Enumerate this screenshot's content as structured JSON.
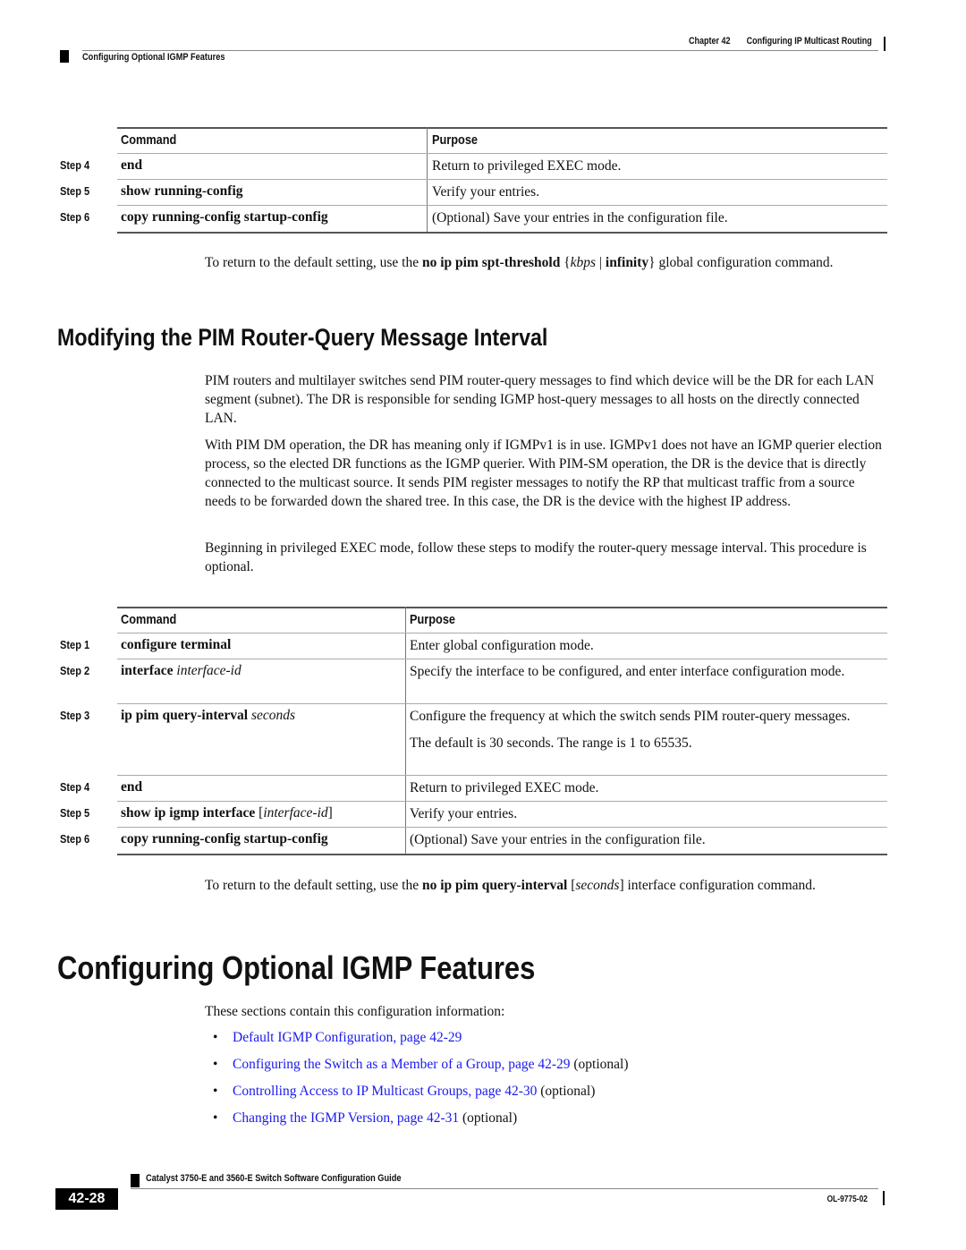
{
  "header": {
    "chapter": "Chapter 42",
    "chapter_title": "Configuring IP Multicast Routing",
    "section": "Configuring Optional IGMP Features"
  },
  "table1": {
    "col_command": "Command",
    "col_purpose": "Purpose",
    "rows": [
      {
        "step": "Step 4",
        "cmd_bold": "end",
        "cmd_rest": "",
        "purpose": [
          "Return to privileged EXEC mode."
        ]
      },
      {
        "step": "Step 5",
        "cmd_bold": "show running-config",
        "cmd_rest": "",
        "purpose": [
          "Verify your entries."
        ]
      },
      {
        "step": "Step 6",
        "cmd_bold": "copy running-config startup-config",
        "cmd_rest": "",
        "purpose": [
          "(Optional) Save your entries in the configuration file."
        ]
      }
    ]
  },
  "para_spt": {
    "t1": "To return to the default setting, use the ",
    "b1": "no ip pim spt-threshold",
    "t2": " {",
    "i1": "kbps",
    "t3": " | ",
    "b2": "infinity",
    "t4": "} global configuration command."
  },
  "section_pim": {
    "heading": "Modifying the PIM Router-Query Message Interval",
    "p1": "PIM routers and multilayer switches send PIM router-query messages to find which device will be the DR for each LAN segment (subnet). The DR is responsible for sending IGMP host-query messages to all hosts on the directly connected LAN.",
    "p2": "With PIM DM operation, the DR has meaning only if IGMPv1 is in use. IGMPv1 does not have an IGMP querier election process, so the elected DR functions as the IGMP querier. With PIM-SM operation, the DR is the device that is directly connected to the multicast source. It sends PIM register messages to notify the RP that multicast traffic from a source needs to be forwarded down the shared tree. In this case, the DR is the device with the highest IP address.",
    "p3": "Beginning in privileged EXEC mode, follow these steps to modify the router-query message interval. This procedure is optional."
  },
  "table2": {
    "col_command": "Command",
    "col_purpose": "Purpose",
    "rows": [
      {
        "step": "Step 1",
        "cmd_bold": "configure terminal",
        "cmd_italic": "",
        "purpose": [
          "Enter global configuration mode."
        ]
      },
      {
        "step": "Step 2",
        "cmd_bold": "interface",
        "cmd_italic": "interface-id",
        "purpose": [
          "Specify the interface to be configured, and enter interface configuration mode."
        ]
      },
      {
        "step": "Step 3",
        "cmd_bold": "ip pim query-interval",
        "cmd_italic": "seconds",
        "purpose": [
          "Configure the frequency at which the switch sends PIM router-query messages.",
          "The default is 30 seconds. The range is 1 to 65535."
        ]
      },
      {
        "step": "Step 4",
        "cmd_bold": "end",
        "cmd_italic": "",
        "purpose": [
          "Return to privileged EXEC mode."
        ]
      },
      {
        "step": "Step 5",
        "cmd_bold": "show ip igmp interface",
        "cmd_bracket_open": "[",
        "cmd_italic": "interface-id",
        "cmd_bracket_close": "]",
        "purpose": [
          "Verify your entries."
        ]
      },
      {
        "step": "Step 6",
        "cmd_bold": "copy running-config startup-config",
        "cmd_italic": "",
        "purpose": [
          "(Optional) Save your entries in the configuration file."
        ]
      }
    ]
  },
  "para_qi": {
    "t1": "To return to the default setting, use the ",
    "b1": "no ip pim query-interval",
    "t2": " [",
    "i1": "seconds",
    "t3": "] interface configuration command."
  },
  "section_igmp": {
    "heading": "Configuring Optional IGMP Features",
    "intro": "These sections contain this configuration information:",
    "bullet_glyph": "•",
    "items": [
      {
        "link": "Default IGMP Configuration, page 42-29",
        "suffix": ""
      },
      {
        "link": "Configuring the Switch as a Member of a Group, page 42-29",
        "suffix": " (optional)"
      },
      {
        "link": "Controlling Access to IP Multicast Groups, page 42-30",
        "suffix": " (optional)"
      },
      {
        "link": "Changing the IGMP Version, page 42-31",
        "suffix": " (optional)"
      }
    ]
  },
  "footer": {
    "guide_title": "Catalyst 3750-E and 3560-E Switch Software Configuration Guide",
    "page_number": "42-28",
    "doc_id": "OL-9775-02"
  },
  "colors": {
    "link": "#1a1aee",
    "text": "#111111"
  }
}
